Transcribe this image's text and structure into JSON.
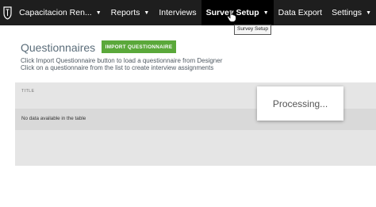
{
  "navbar": {
    "logo_icon": "shield-logo-icon",
    "items": [
      {
        "label": "Capacitacion Ren...",
        "has_caret": true
      },
      {
        "label": "Reports",
        "has_caret": true
      },
      {
        "label": "Interviews",
        "has_caret": false
      },
      {
        "label": "Survey Setup",
        "has_caret": true,
        "active": true
      },
      {
        "label": "Data Export",
        "has_caret": false
      },
      {
        "label": "Settings",
        "has_caret": true
      }
    ],
    "caret_glyph": "▼",
    "tooltip": "Survey Setup"
  },
  "main": {
    "title": "Questionnaires",
    "import_button": "IMPORT QUESTIONNAIRE",
    "hint_line1": "Click Import Questionnaire button to load a questionnaire from Designer",
    "hint_line2": "Click on a questionnaire from the list to create interview assignments"
  },
  "table": {
    "column_header": "TITLE",
    "empty_message": "No data available in the table",
    "processing_text": "Processing..."
  },
  "colors": {
    "navbar_bg": "#1e1e1e",
    "active_nav_bg": "#000000",
    "import_button_bg": "#5aa83a",
    "table_bg": "#e5e5e5"
  }
}
